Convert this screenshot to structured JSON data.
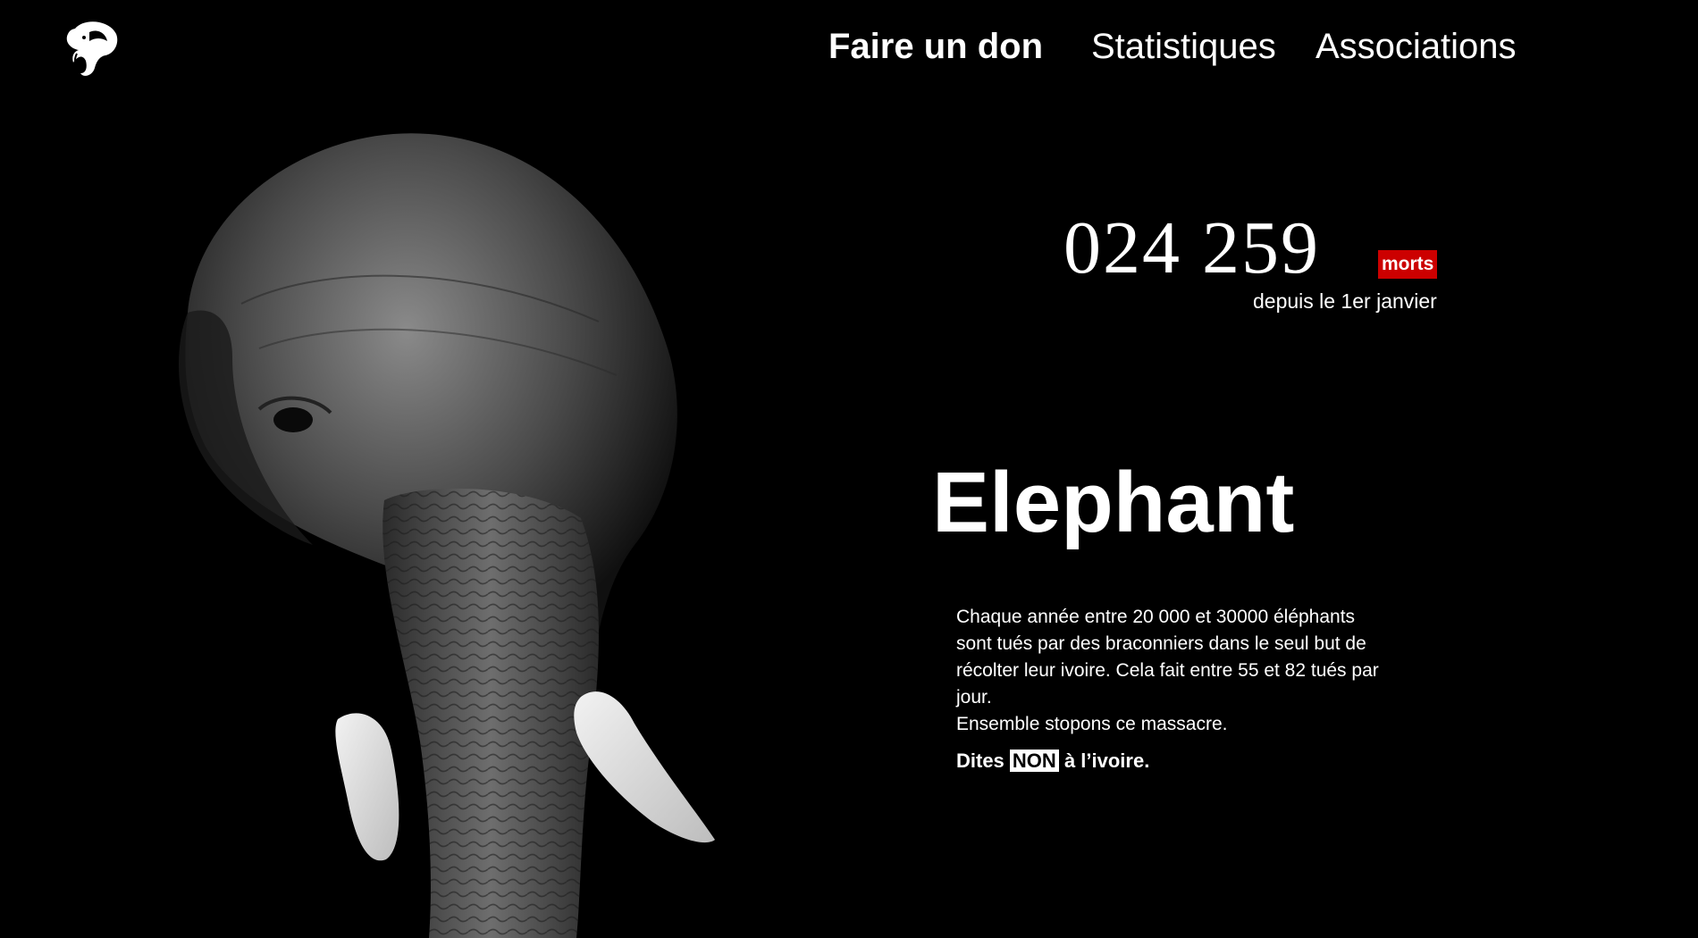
{
  "nav": {
    "donate_label": "Faire un don",
    "stats_label": "Statistiques",
    "associations_label": "Associations"
  },
  "counter": {
    "value": "024 259",
    "unit": "morts",
    "caption": "depuis le 1er janvier",
    "unit_color": "#cc0000"
  },
  "hero": {
    "title": "Elephant",
    "description_lines": [
      "Chaque année entre 20 000 et 30000 éléphants",
      "sont tués par des braconniers dans le seul but de",
      "récolter leur ivoire. Cela fait entre 55 et 82 tués par",
      "jour.",
      "Ensemble stopons ce massacre."
    ],
    "cta_prefix": "Dites",
    "cta_highlight": "NON",
    "cta_suffix": "à l’ivoire."
  },
  "icons": {
    "logo": "elephant-logo-icon",
    "hero_image": "elephant-photo"
  },
  "colors": {
    "background": "#000000",
    "text": "#ffffff",
    "accent": "#cc0000"
  }
}
